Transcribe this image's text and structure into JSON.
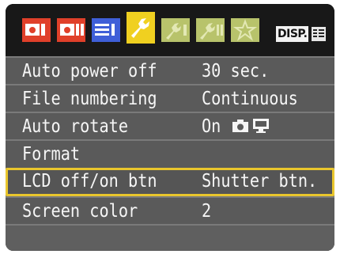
{
  "tabs": [
    {
      "icon": "shooting-menu-1-icon",
      "color": "#e0402a"
    },
    {
      "icon": "shooting-menu-2-icon",
      "color": "#e0402a"
    },
    {
      "icon": "playback-menu-icon",
      "color": "#3f5fd8"
    },
    {
      "icon": "setup-menu-wrench-icon",
      "color": "#f0d020",
      "active": true
    },
    {
      "icon": "setup-menu-2-icon",
      "color": "#b8c36b"
    },
    {
      "icon": "setup-menu-3-icon",
      "color": "#b8c36b"
    },
    {
      "icon": "my-menu-star-icon",
      "color": "#b8c36b"
    }
  ],
  "disp_label": "DISP.",
  "menu": [
    {
      "label": "Auto power off",
      "value": "30 sec."
    },
    {
      "label": "File numbering",
      "value": "Continuous"
    },
    {
      "label": "Auto rotate",
      "value": "On"
    },
    {
      "label": "Format",
      "value": ""
    },
    {
      "label": "LCD off/on btn",
      "value": "Shutter btn.",
      "selected": true
    },
    {
      "label": "Screen color",
      "value": "2"
    }
  ],
  "colors": {
    "highlight": "#e9c62d",
    "row_background": "#5a5a5a",
    "text": "#f6f6f6"
  }
}
